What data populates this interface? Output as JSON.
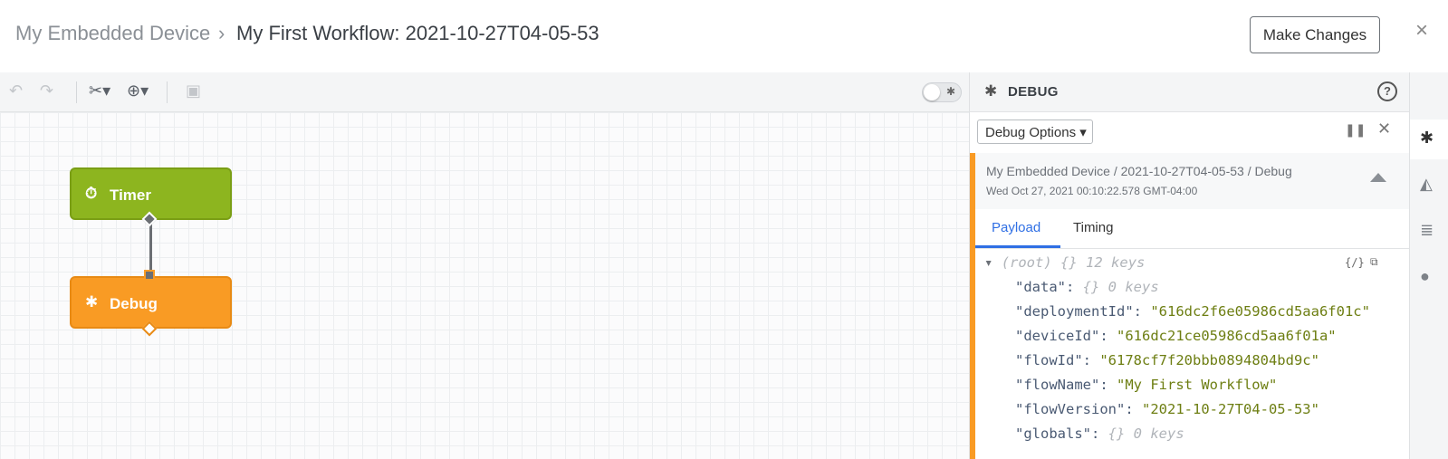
{
  "header": {
    "breadcrumb_parent": "My Embedded Device",
    "breadcrumb_separator": "›",
    "breadcrumb_current": "My First Workflow: 2021-10-27T04-05-53",
    "make_changes_label": "Make Changes",
    "close_icon": "×"
  },
  "toolbar": {
    "undo_icon": "↶",
    "redo_icon": "↷",
    "cut_icon": "✂▾",
    "zoom_icon": "⊕▾",
    "comment_icon": "▣"
  },
  "nodes": [
    {
      "label": "Timer",
      "icon": "⏱",
      "color": "#8db51f"
    },
    {
      "label": "Debug",
      "icon": "✱",
      "color": "#f99b24"
    }
  ],
  "debug_panel": {
    "title": "DEBUG",
    "help_icon": "?",
    "options_label": "Debug Options ▾",
    "pause_icon": "❚❚",
    "close_icon": "✕",
    "message": {
      "path": "My Embedded Device / 2021-10-27T04-05-53 / Debug",
      "timestamp": "Wed Oct 27, 2021 00:10:22.578 GMT-04:00"
    },
    "tabs": [
      {
        "label": "Payload",
        "active": true
      },
      {
        "label": "Timing",
        "active": false
      }
    ],
    "json": {
      "root_toggle": "▾",
      "root_label": "(root)",
      "root_braces": "{}",
      "root_count": "12 keys",
      "entries": [
        {
          "key": "\"data\":",
          "value": "",
          "meta": "{}  0 keys"
        },
        {
          "key": "\"deploymentId\":",
          "value": "\"616dc2f6e05986cd5aa6f01c\"",
          "meta": ""
        },
        {
          "key": "\"deviceId\":",
          "value": "\"616dc21ce05986cd5aa6f01a\"",
          "meta": ""
        },
        {
          "key": "\"flowId\":",
          "value": "\"6178cf7f20bbb0894804bd9c\"",
          "meta": ""
        },
        {
          "key": "\"flowName\":",
          "value": "\"My First Workflow\"",
          "meta": ""
        },
        {
          "key": "\"flowVersion\":",
          "value": "\"2021-10-27T04-05-53\"",
          "meta": ""
        },
        {
          "key": "\"globals\":",
          "value": "",
          "meta": "{}  0 keys"
        }
      ]
    }
  },
  "rail": {
    "icons": [
      "bug-icon",
      "chart-icon",
      "database-icon",
      "globe-icon"
    ]
  }
}
